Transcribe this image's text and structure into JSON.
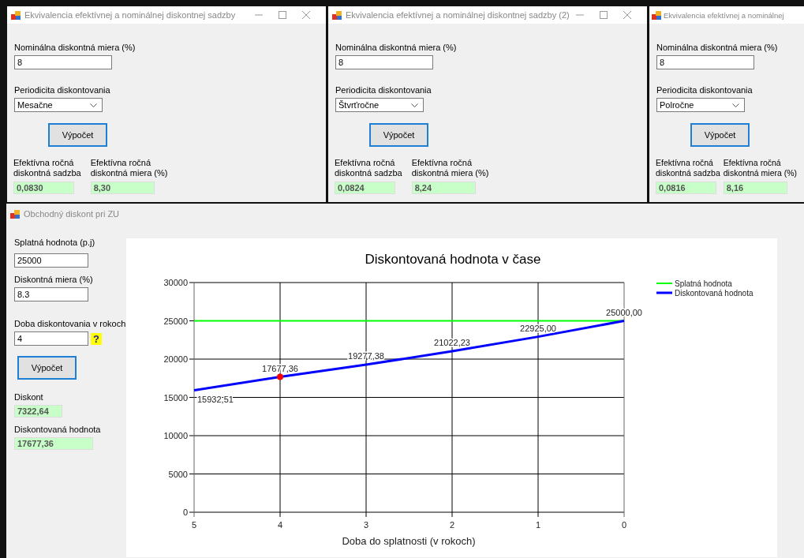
{
  "windows": [
    {
      "title": "Ekvivalencia efektívnej a nominálnej diskontnej sadzby",
      "nominal_label": "Nominálna diskontná miera (%)",
      "nominal_value": "8",
      "period_label": "Periodicita diskontovania",
      "period_value": "Mesačne",
      "button": "Výpočet",
      "results": [
        {
          "label": "Efektívna ročná\ndiskontná sadzba",
          "value": "0,0830"
        },
        {
          "label": "Efektívna ročná\ndiskontná miera (%)",
          "value": "8,30"
        }
      ]
    },
    {
      "title": "Ekvivalencia efektívnej a nominálnej diskontnej sadzby (2)",
      "nominal_label": "Nominálna diskontná miera (%)",
      "nominal_value": "8",
      "period_label": "Periodicita diskontovania",
      "period_value": "Štvrťročne",
      "button": "Výpočet",
      "results": [
        {
          "label": "Efektívna ročná\ndiskontná sadzba",
          "value": "0,0824"
        },
        {
          "label": "Efektívna ročná\ndiskontná miera (%)",
          "value": "8,24"
        }
      ]
    },
    {
      "title": "Ekvivalencia efektívnej a nominálnej",
      "nominal_label": "Nominálna diskontná miera (%)",
      "nominal_value": "8",
      "period_label": "Periodicita diskontovania",
      "period_value": "Polročne",
      "button": "Výpočet",
      "results": [
        {
          "label": "Efektívna ročná\ndiskontná sadzba",
          "value": "0,0816"
        },
        {
          "label": "Efektívna ročná\ndiskontná miera (%)",
          "value": "8,16"
        }
      ]
    }
  ],
  "main_window": {
    "title": "Obchodný diskont pri ZU",
    "inputs": [
      {
        "label": "Splatná hodnota (p.j)",
        "value": "25000"
      },
      {
        "label": "Diskontná miera (%)",
        "value": "8.3"
      },
      {
        "label": "Doba diskontovania v rokoch",
        "value": "4",
        "help": "?"
      }
    ],
    "button": "Výpočet",
    "outputs": [
      {
        "label": "Diskont",
        "value": "7322,64"
      },
      {
        "label": "Diskontovaná hodnota",
        "value": "17677,36"
      }
    ],
    "chart_data": {
      "type": "line",
      "title": "Diskontovaná hodnota v čase",
      "xlabel": "Doba do splatnosti (v rokoch)",
      "categories": [
        "5",
        "4",
        "3",
        "2",
        "1",
        "0"
      ],
      "ylim": [
        0,
        30000
      ],
      "yticks": [
        0,
        5000,
        10000,
        15000,
        20000,
        25000,
        30000
      ],
      "series": [
        {
          "name": "Splatná hodnota",
          "color": "#00ff00",
          "values": [
            25000,
            25000,
            25000,
            25000,
            25000,
            25000
          ]
        },
        {
          "name": "Diskontovaná hodnota",
          "color": "#0000ff",
          "values": [
            15932.51,
            17677.36,
            19277.38,
            21022.23,
            22925.0,
            25000.0
          ],
          "value_labels": [
            "15932,51",
            "17677,36",
            "19277,38",
            "21022,23",
            "22925,00",
            "25000,00"
          ]
        }
      ],
      "grid": true,
      "legend": true
    }
  }
}
